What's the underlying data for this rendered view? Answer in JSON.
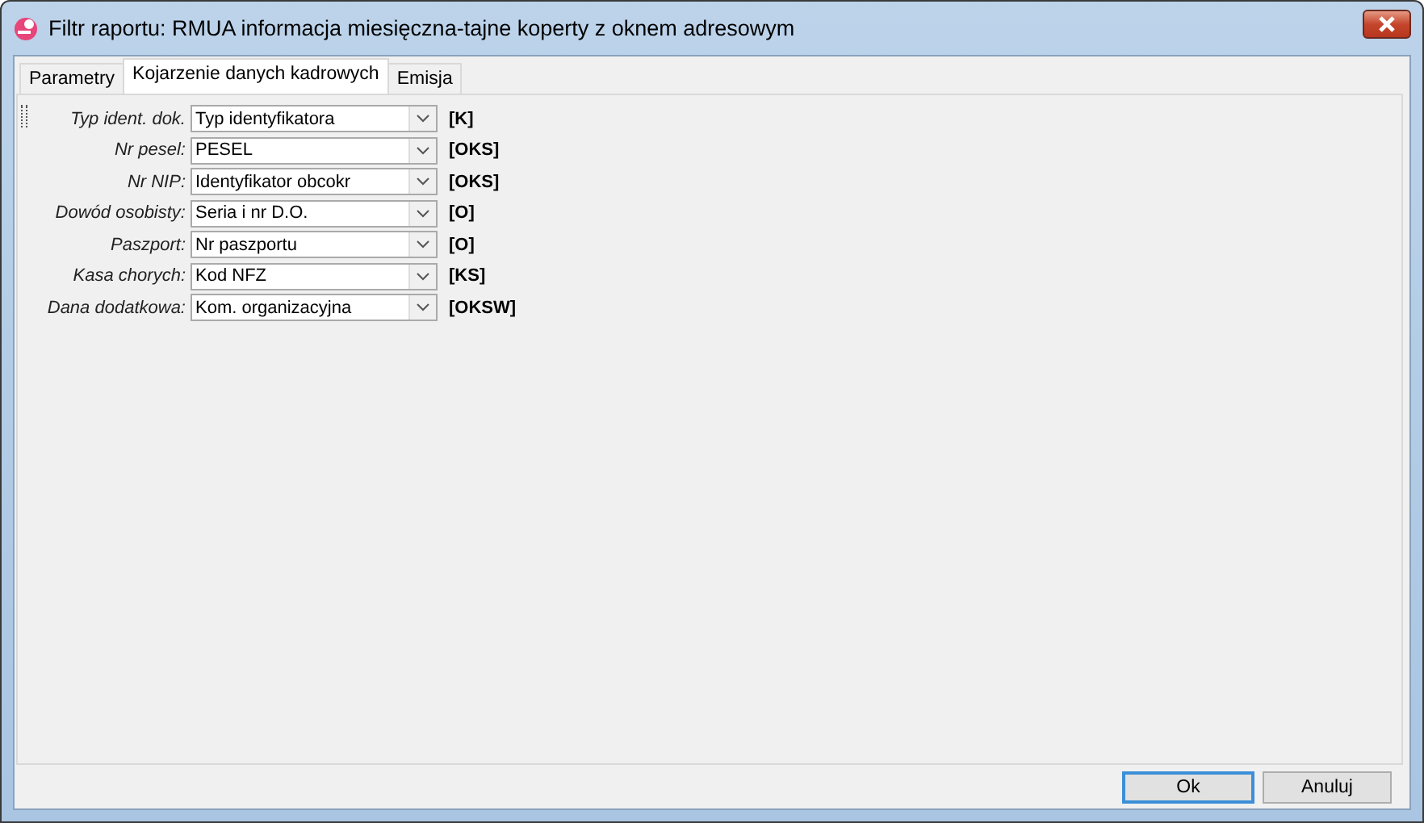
{
  "window": {
    "title": "Filtr raportu: RMUA informacja miesięczna-tajne koperty z oknem adresowym"
  },
  "tabs": [
    {
      "label": "Parametry",
      "selected": false
    },
    {
      "label": "Kojarzenie danych kadrowych",
      "selected": true
    },
    {
      "label": "Emisja",
      "selected": false
    }
  ],
  "fields": [
    {
      "label": "Typ ident. dok.",
      "value": "Typ identyfikatora",
      "code": "[K]"
    },
    {
      "label": "Nr pesel:",
      "value": "PESEL",
      "code": "[OKS]"
    },
    {
      "label": "Nr NIP:",
      "value": "Identyfikator obcokr",
      "code": "[OKS]"
    },
    {
      "label": "Dowód osobisty:",
      "value": "Seria i nr D.O.",
      "code": "[O]"
    },
    {
      "label": "Paszport:",
      "value": "Nr paszportu",
      "code": "[O]"
    },
    {
      "label": "Kasa chorych:",
      "value": "Kod NFZ",
      "code": "[KS]"
    },
    {
      "label": "Dana dodatkowa:",
      "value": "Kom. organizacyjna",
      "code": "[OKSW]"
    }
  ],
  "buttons": [
    {
      "label": "Ok",
      "default": true
    },
    {
      "label": "Anuluj",
      "default": false
    }
  ]
}
